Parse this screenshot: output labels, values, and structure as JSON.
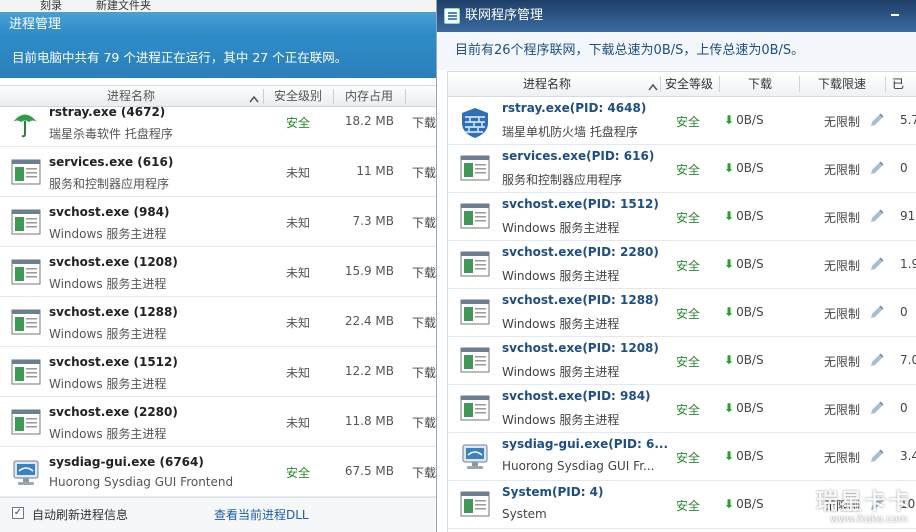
{
  "background": {
    "menu_items": [
      "刻录",
      "新建文件夹"
    ]
  },
  "left_window": {
    "title": "进程管理",
    "summary": "目前电脑中共有 79 个进程正在运行，其中 27 个正在联网。",
    "columns": {
      "name": "进程名称",
      "safety": "安全级别",
      "memory": "内存占用"
    },
    "rows": [
      {
        "name": "rstray.exe (4672)",
        "desc": "瑞星杀毒软件 托盘程序",
        "safety": "安全",
        "memory": "18.2 MB",
        "action": "下载",
        "icon": "umbrella-icon",
        "safe": true
      },
      {
        "name": "services.exe (616)",
        "desc": "服务和控制器应用程序",
        "safety": "未知",
        "memory": "11 MB",
        "action": "下载",
        "icon": "window-app-icon",
        "safe": false
      },
      {
        "name": "svchost.exe (984)",
        "desc": "Windows 服务主进程",
        "safety": "未知",
        "memory": "7.3 MB",
        "action": "下载",
        "icon": "window-app-icon",
        "safe": false
      },
      {
        "name": "svchost.exe (1208)",
        "desc": "Windows 服务主进程",
        "safety": "未知",
        "memory": "15.9 MB",
        "action": "下载",
        "icon": "window-app-icon",
        "safe": false
      },
      {
        "name": "svchost.exe (1288)",
        "desc": "Windows 服务主进程",
        "safety": "未知",
        "memory": "22.4 MB",
        "action": "下载",
        "icon": "window-app-icon",
        "safe": false
      },
      {
        "name": "svchost.exe (1512)",
        "desc": "Windows 服务主进程",
        "safety": "未知",
        "memory": "12.2 MB",
        "action": "下载",
        "icon": "window-app-icon",
        "safe": false
      },
      {
        "name": "svchost.exe (2280)",
        "desc": "Windows 服务主进程",
        "safety": "未知",
        "memory": "11.8 MB",
        "action": "下载",
        "icon": "window-app-icon",
        "safe": false
      },
      {
        "name": "sysdiag-gui.exe (6764)",
        "desc": "Huorong Sysdiag GUI Frontend",
        "safety": "安全",
        "memory": "67.5 MB",
        "action": "下载",
        "icon": "monitor-icon",
        "safe": true
      }
    ],
    "footer": {
      "auto_refresh_label": "自动刷新进程信息",
      "auto_refresh_checked": true,
      "dll_link": "查看当前进程DLL"
    }
  },
  "right_window": {
    "title": "联网程序管理",
    "summary": "目前有26个程序联网，下载总速为0B/S，上传总速为0B/S。",
    "columns": {
      "name": "进程名称",
      "safety": "安全等级",
      "download": "下载",
      "limit": "下载限速",
      "upload": "已"
    },
    "rows": [
      {
        "name": "rstray.exe(PID: 4648)",
        "desc": "瑞星单机防火墙 托盘程序",
        "safety": "安全",
        "download": "0B/S",
        "limit": "无限制",
        "upload": "5.7",
        "icon": "firewall-icon"
      },
      {
        "name": "services.exe(PID: 616)",
        "desc": "服务和控制器应用程序",
        "safety": "安全",
        "download": "0B/S",
        "limit": "无限制",
        "upload": "0",
        "icon": "window-app-icon"
      },
      {
        "name": "svchost.exe(PID: 1512)",
        "desc": "Windows 服务主进程",
        "safety": "安全",
        "download": "0B/S",
        "limit": "无限制",
        "upload": "91",
        "icon": "window-app-icon"
      },
      {
        "name": "svchost.exe(PID: 2280)",
        "desc": "Windows 服务主进程",
        "safety": "安全",
        "download": "0B/S",
        "limit": "无限制",
        "upload": "1.9",
        "icon": "window-app-icon"
      },
      {
        "name": "svchost.exe(PID: 1288)",
        "desc": "Windows 服务主进程",
        "safety": "安全",
        "download": "0B/S",
        "limit": "无限制",
        "upload": "0",
        "icon": "window-app-icon"
      },
      {
        "name": "svchost.exe(PID: 1208)",
        "desc": "Windows 服务主进程",
        "safety": "安全",
        "download": "0B/S",
        "limit": "无限制",
        "upload": "7.0",
        "icon": "window-app-icon"
      },
      {
        "name": "svchost.exe(PID: 984)",
        "desc": "Windows 服务主进程",
        "safety": "安全",
        "download": "0B/S",
        "limit": "无限制",
        "upload": "0",
        "icon": "window-app-icon"
      },
      {
        "name": "sysdiag-gui.exe(PID: 6...",
        "desc": "Huorong Sysdiag GUI Fr...",
        "safety": "安全",
        "download": "0B/S",
        "limit": "无限制",
        "upload": "3.4",
        "icon": "monitor-icon"
      },
      {
        "name": "System(PID: 4)",
        "desc": "System",
        "safety": "安全",
        "download": "0B/S",
        "limit": "无限制",
        "upload": "10",
        "icon": "window-app-icon"
      }
    ]
  },
  "watermark": {
    "text": "瑞星卡卡",
    "url": "www.ikaka.com"
  },
  "colors": {
    "safe": "#2a8a2a",
    "unknown": "#555555",
    "title_blue": "#2c87c4",
    "link": "#1a5fa8"
  }
}
